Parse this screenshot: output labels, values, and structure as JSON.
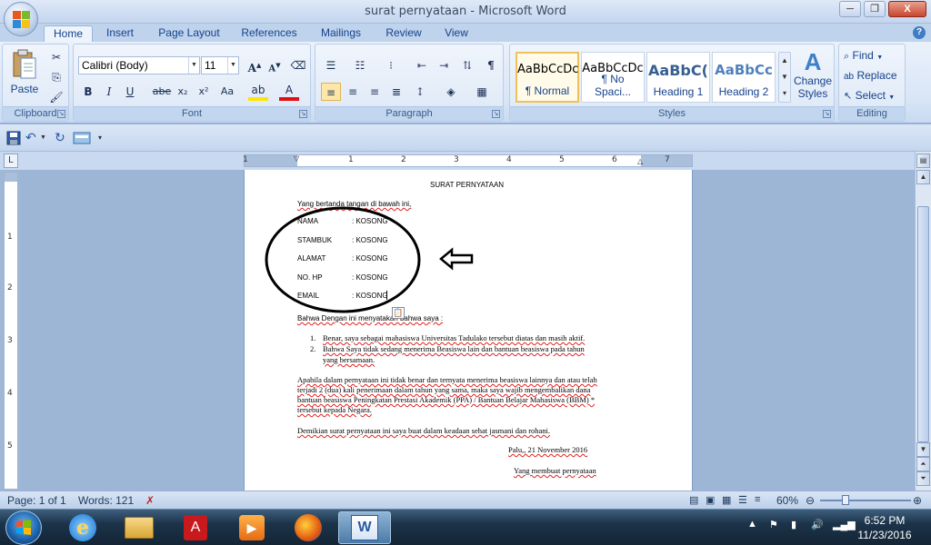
{
  "window": {
    "title": "surat pernyataan - Microsoft Word"
  },
  "window_controls": {
    "minimize": "─",
    "maximize": "❐",
    "close": "X"
  },
  "ribbon_tabs": [
    "Home",
    "Insert",
    "Page Layout",
    "References",
    "Mailings",
    "Review",
    "View"
  ],
  "ribbon": {
    "clipboard": {
      "paste": "Paste",
      "group": "Clipboard"
    },
    "font": {
      "name": "Calibri (Body)",
      "size": "11",
      "group": "Font"
    },
    "paragraph": {
      "group": "Paragraph"
    },
    "styles": {
      "group": "Styles",
      "items": [
        {
          "sample": "AaBbCcDc",
          "name": "¶ Normal"
        },
        {
          "sample": "AaBbCcDc",
          "name": "¶ No Spaci..."
        },
        {
          "sample": "AaBbC(",
          "name": "Heading 1"
        },
        {
          "sample": "AaBbCc",
          "name": "Heading 2"
        }
      ],
      "change_styles_1": "Change",
      "change_styles_2": "Styles"
    },
    "editing": {
      "find": "Find",
      "replace": "Replace",
      "select": "Select",
      "group": "Editing"
    }
  },
  "document": {
    "title": "SURAT PERNYATAAN",
    "intro": "Yang bertanda tangan di bawah ini,",
    "fields": [
      {
        "label": "NAMA",
        "value": ": KOSONG"
      },
      {
        "label": "STAMBUK",
        "value": ": KOSONG"
      },
      {
        "label": "ALAMAT",
        "value": ": KOSONG"
      },
      {
        "label": "NO. HP",
        "value": ": KOSONG"
      },
      {
        "label": "EMAIL",
        "value": ": KOSONG"
      }
    ],
    "statement": "Bahwa Dengan ini menyatakan bahwa saya :",
    "list": [
      {
        "num": "1.",
        "text": "Benar, saya sebagai mahasiswa Universitas Tadulako tersebut diatas dan masih aktif."
      },
      {
        "num": "2.",
        "text": "Bahwa Saya tidak sedang menerima Beasiswa lain dan bantuan beasiswa pada tahun"
      },
      {
        "num": "",
        "text": "yang bersamaan."
      }
    ],
    "para_lines": [
      "Apabila dalam pernyataan ini tidak benar dan ternyata menerima beasiswa lainnya dan atau telah",
      "terjadi 2 (dua) kali penerimaan dalam tahun yang sama, maka saya wajib mengembalikan dana",
      "bantuan beasiswa Peningkatan Prestasi Akademik (PPA) / Bantuan Belajar Mahasiswa (BBM) *",
      "tersebut kepada Negara."
    ],
    "closing": "Demikian surat pernyataan ini saya buat dalam keadaan sehat jasmani dan rohani.",
    "place_date": "Palu,, 21 November 2016",
    "signer": "Yang membuat pernyataan"
  },
  "ruler": {
    "numbers": [
      "1",
      "1",
      "2",
      "3",
      "4",
      "5",
      "6",
      "7"
    ],
    "vnumbers": [
      "1",
      "2",
      "3",
      "4",
      "5"
    ]
  },
  "status": {
    "page": "Page: 1 of 1",
    "words": "Words: 121",
    "zoom": "60%"
  },
  "taskbar": {
    "time": "6:52 PM",
    "date": "11/23/2016"
  },
  "colors": {
    "accent": "#15428b",
    "annotation": "#000000"
  }
}
